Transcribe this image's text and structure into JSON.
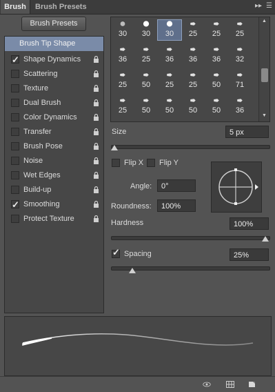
{
  "tabs": [
    {
      "label": "Brush",
      "active": true
    },
    {
      "label": "Brush Presets",
      "active": false
    }
  ],
  "panel_menu_icons": [
    "double-arrow-icon",
    "panel-menu-icon"
  ],
  "brush_presets_button": "Brush Presets",
  "sidebar": {
    "items": [
      {
        "label": "Brush Tip Shape",
        "selected": true,
        "has_checkbox": false,
        "checked": false,
        "locked": false
      },
      {
        "label": "Shape Dynamics",
        "selected": false,
        "has_checkbox": true,
        "checked": true,
        "locked": true
      },
      {
        "label": "Scattering",
        "selected": false,
        "has_checkbox": true,
        "checked": false,
        "locked": true
      },
      {
        "label": "Texture",
        "selected": false,
        "has_checkbox": true,
        "checked": false,
        "locked": true
      },
      {
        "label": "Dual Brush",
        "selected": false,
        "has_checkbox": true,
        "checked": false,
        "locked": true
      },
      {
        "label": "Color Dynamics",
        "selected": false,
        "has_checkbox": true,
        "checked": false,
        "locked": true
      },
      {
        "label": "Transfer",
        "selected": false,
        "has_checkbox": true,
        "checked": false,
        "locked": true
      },
      {
        "label": "Brush Pose",
        "selected": false,
        "has_checkbox": true,
        "checked": false,
        "locked": true
      },
      {
        "label": "Noise",
        "selected": false,
        "has_checkbox": true,
        "checked": false,
        "locked": true
      },
      {
        "label": "Wet Edges",
        "selected": false,
        "has_checkbox": true,
        "checked": false,
        "locked": true
      },
      {
        "label": "Build-up",
        "selected": false,
        "has_checkbox": true,
        "checked": false,
        "locked": true
      },
      {
        "label": "Smoothing",
        "selected": false,
        "has_checkbox": true,
        "checked": true,
        "locked": true
      },
      {
        "label": "Protect Texture",
        "selected": false,
        "has_checkbox": true,
        "checked": false,
        "locked": true
      }
    ]
  },
  "brush_tips": {
    "rows": [
      [
        "30",
        "30",
        "30",
        "25",
        "25",
        "25"
      ],
      [
        "36",
        "25",
        "36",
        "36",
        "36",
        "32"
      ],
      [
        "25",
        "50",
        "25",
        "25",
        "50",
        "71"
      ],
      [
        "25",
        "50",
        "50",
        "50",
        "50",
        "36"
      ]
    ],
    "selected_index": 2
  },
  "size": {
    "label": "Size",
    "value": "5 px",
    "fraction": 0.0
  },
  "flip_x": {
    "label": "Flip X",
    "checked": false
  },
  "flip_y": {
    "label": "Flip Y",
    "checked": false
  },
  "angle": {
    "label": "Angle:",
    "value": "0°"
  },
  "roundness": {
    "label": "Roundness:",
    "value": "100%"
  },
  "hardness": {
    "label": "Hardness",
    "value": "100%",
    "fraction": 1.0
  },
  "spacing": {
    "label": "Spacing",
    "checked": true,
    "value": "25%",
    "fraction": 0.12
  },
  "colors": {
    "panel": "#535353",
    "selection": "#7a8ba8",
    "field": "#3a3a3a"
  }
}
